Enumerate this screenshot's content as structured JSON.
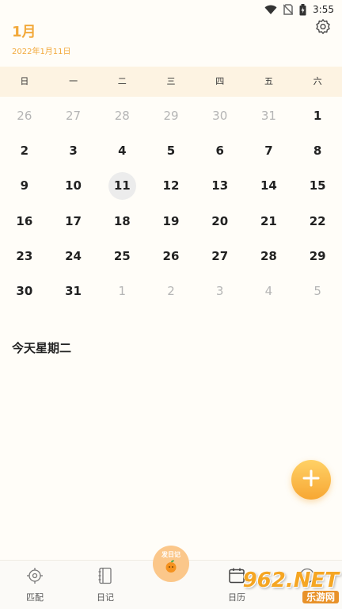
{
  "status_bar": {
    "time": "3:55",
    "icons": [
      "wifi-icon",
      "no-sim-icon",
      "battery-charging-icon"
    ]
  },
  "header": {
    "month_title": "1月",
    "date_subtitle": "2022年1月11日",
    "settings_icon": "gear-icon"
  },
  "calendar": {
    "weekdays": [
      "日",
      "一",
      "二",
      "三",
      "四",
      "五",
      "六"
    ],
    "days": [
      {
        "label": "26",
        "muted": true
      },
      {
        "label": "27",
        "muted": true
      },
      {
        "label": "28",
        "muted": true
      },
      {
        "label": "29",
        "muted": true
      },
      {
        "label": "30",
        "muted": true
      },
      {
        "label": "31",
        "muted": true
      },
      {
        "label": "1",
        "muted": false
      },
      {
        "label": "2",
        "muted": false
      },
      {
        "label": "3",
        "muted": false
      },
      {
        "label": "4",
        "muted": false
      },
      {
        "label": "5",
        "muted": false
      },
      {
        "label": "6",
        "muted": false
      },
      {
        "label": "7",
        "muted": false
      },
      {
        "label": "8",
        "muted": false
      },
      {
        "label": "9",
        "muted": false
      },
      {
        "label": "10",
        "muted": false
      },
      {
        "label": "11",
        "muted": false,
        "today": true
      },
      {
        "label": "12",
        "muted": false
      },
      {
        "label": "13",
        "muted": false
      },
      {
        "label": "14",
        "muted": false
      },
      {
        "label": "15",
        "muted": false
      },
      {
        "label": "16",
        "muted": false
      },
      {
        "label": "17",
        "muted": false
      },
      {
        "label": "18",
        "muted": false
      },
      {
        "label": "19",
        "muted": false
      },
      {
        "label": "20",
        "muted": false
      },
      {
        "label": "21",
        "muted": false
      },
      {
        "label": "22",
        "muted": false
      },
      {
        "label": "23",
        "muted": false
      },
      {
        "label": "24",
        "muted": false
      },
      {
        "label": "25",
        "muted": false
      },
      {
        "label": "26",
        "muted": false
      },
      {
        "label": "27",
        "muted": false
      },
      {
        "label": "28",
        "muted": false
      },
      {
        "label": "29",
        "muted": false
      },
      {
        "label": "30",
        "muted": false
      },
      {
        "label": "31",
        "muted": false
      },
      {
        "label": "1",
        "muted": true
      },
      {
        "label": "2",
        "muted": true
      },
      {
        "label": "3",
        "muted": true
      },
      {
        "label": "4",
        "muted": true
      },
      {
        "label": "5",
        "muted": true
      }
    ]
  },
  "section": {
    "title": "今天星期二"
  },
  "fab": {
    "icon": "plus-icon"
  },
  "bottom_nav": {
    "items": [
      {
        "label": "匹配",
        "icon": "target-icon"
      },
      {
        "label": "日记",
        "icon": "notebook-icon"
      },
      {
        "label": "日历",
        "icon": "calendar-icon"
      },
      {
        "label": "",
        "icon": "profile-icon"
      }
    ],
    "center": {
      "label": "发日记",
      "icon": "orange-fruit-icon"
    }
  },
  "watermark": {
    "main": "962.NET",
    "sub": "乐游网"
  },
  "colors": {
    "accent": "#f2a93b",
    "weekday_bg": "#fdf3e2",
    "background": "#fffdf8",
    "today_bg": "#ececec"
  }
}
